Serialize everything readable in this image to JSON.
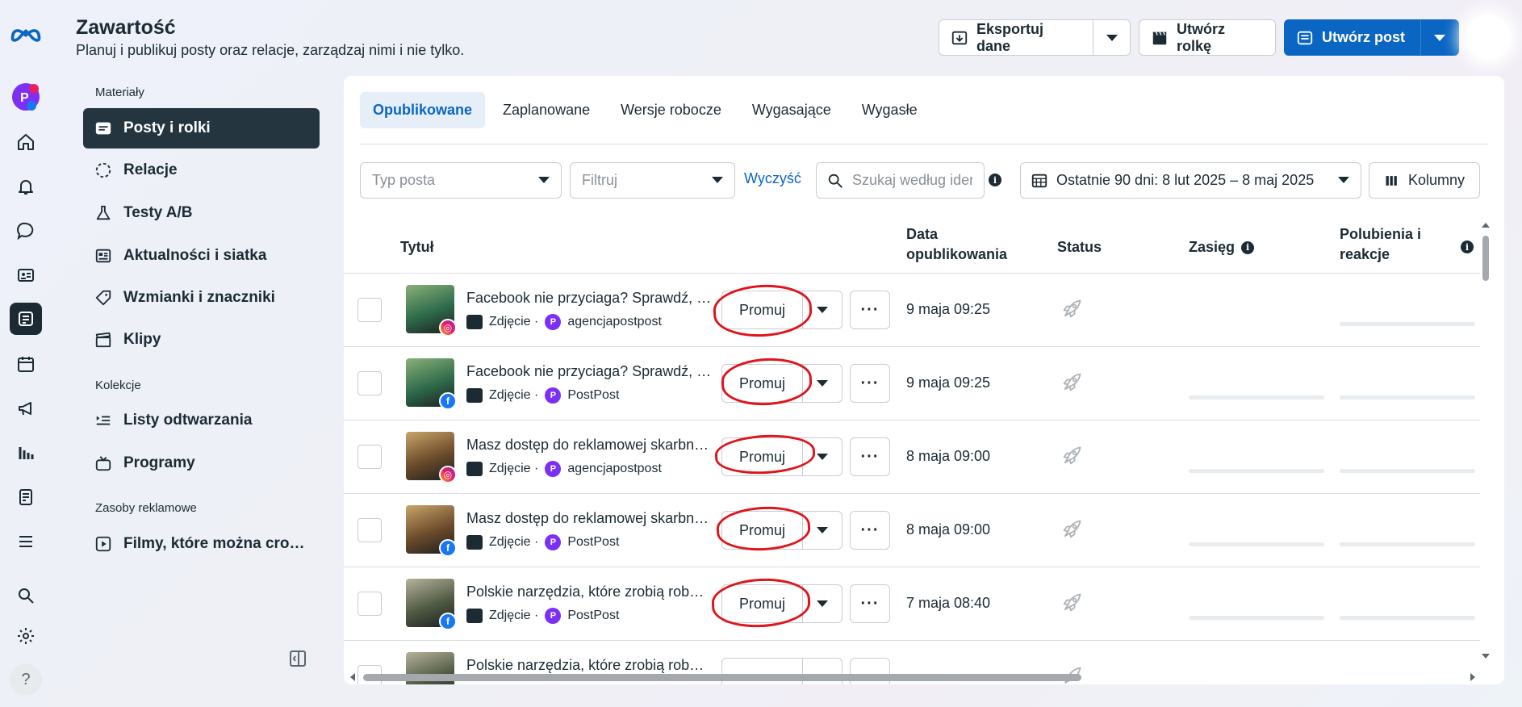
{
  "header": {
    "title": "Zawartość",
    "subtitle": "Planuj i publikuj posty oraz relacje, zarządzaj nimi i nie tylko.",
    "export_label": "Eksportuj dane",
    "reel_label": "Utwórz rolkę",
    "post_label": "Utwórz post"
  },
  "rail": {
    "icons": [
      "meta-logo-icon",
      "profile-avatar-icon",
      "home-icon",
      "bell-icon",
      "chat-icon",
      "contact-card-icon",
      "content-icon",
      "calendar-icon",
      "megaphone-icon",
      "insights-icon",
      "document-list-icon",
      "menu-icon",
      "search-icon",
      "gear-icon",
      "help-icon"
    ]
  },
  "sidebar": {
    "sections": {
      "materials": "Materiały",
      "collections": "Kolekcje",
      "ad_assets": "Zasoby reklamowe"
    },
    "items": [
      {
        "label": "Posty i rolki"
      },
      {
        "label": "Relacje"
      },
      {
        "label": "Testy A/B"
      },
      {
        "label": "Aktualności i siatka"
      },
      {
        "label": "Wzmianki i znaczniki"
      },
      {
        "label": "Klipy"
      },
      {
        "label": "Listy odtwarzania"
      },
      {
        "label": "Programy"
      },
      {
        "label": "Filmy, które można cro…"
      }
    ]
  },
  "tabs": [
    {
      "label": "Opublikowane",
      "active": true
    },
    {
      "label": "Zaplanowane"
    },
    {
      "label": "Wersje robocze"
    },
    {
      "label": "Wygasające"
    },
    {
      "label": "Wygasłe"
    }
  ],
  "filters": {
    "post_type_placeholder": "Typ posta",
    "filter_placeholder": "Filtruj",
    "clear_label": "Wyczyść",
    "search_placeholder": "Szukaj według iden",
    "date_range": "Ostatnie 90 dni: 8 lut 2025 – 8 maj 2025",
    "columns_label": "Kolumny"
  },
  "table": {
    "headers": {
      "title": "Tytuł",
      "date_line1": "Data",
      "date_line2": "opublikowania",
      "status": "Status",
      "reach": "Zasięg",
      "likes_line1": "Polubienia i",
      "likes_line2": "reakcje"
    },
    "promote_label": "Promuj",
    "rows": [
      {
        "title": "Facebook nie przyciaga? Sprawdź, dla…",
        "type": "Zdjęcie ·",
        "account": "agencjapostpost",
        "platform": "instagram",
        "date": "9 maja 09:25"
      },
      {
        "title": "Facebook nie przyciaga? Sprawdź, dla…",
        "type": "Zdjęcie ·",
        "account": "PostPost",
        "platform": "facebook",
        "date": "9 maja 09:25"
      },
      {
        "title": "Masz dostęp do reklamowej skarbnic…",
        "type": "Zdjęcie ·",
        "account": "agencjapostpost",
        "platform": "instagram",
        "date": "8 maja 09:00"
      },
      {
        "title": "Masz dostęp do reklamowej skarbnic…",
        "type": "Zdjęcie ·",
        "account": "PostPost",
        "platform": "facebook",
        "date": "8 maja 09:00"
      },
      {
        "title": "Polskie narzędzia, które zrobią robotę…",
        "type": "Zdjęcie ·",
        "account": "PostPost",
        "platform": "facebook",
        "date": "7 maja 08:40"
      },
      {
        "title": "Polskie narzędzia, które zrobią robotę…",
        "type": "",
        "account": "",
        "platform": "",
        "date": ""
      }
    ]
  },
  "colors": {
    "accent": "#0a66c2",
    "sidebar_active": "#253540",
    "annotation_red": "#e0141a",
    "instagram_badge": "#e91e63",
    "facebook_badge": "#1877f2"
  }
}
